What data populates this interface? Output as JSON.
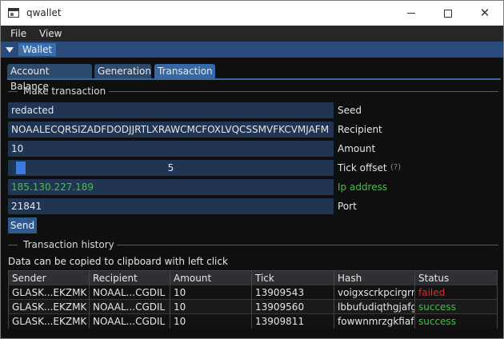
{
  "window": {
    "title": "qwallet"
  },
  "menu": {
    "file": "File",
    "view": "View"
  },
  "wallet_header": {
    "title": "Wallet"
  },
  "tabs": [
    {
      "label": "Account Balance",
      "active": false
    },
    {
      "label": "Generation",
      "active": false
    },
    {
      "label": "Transaction",
      "active": true
    }
  ],
  "make_transaction": {
    "section_label": "Make transaction",
    "seed": {
      "value": "redacted",
      "label": "Seed"
    },
    "recipient": {
      "value": "NOAALECQRSIZADFDODJJRTLXRAWCMCFOXLVQCSSMVFKCVMJAFM",
      "label": "Recipient"
    },
    "amount": {
      "value": "10",
      "label": "Amount"
    },
    "tick_offset": {
      "value": "5",
      "label": "Tick offset",
      "help": "(?)"
    },
    "ip_address": {
      "value": "185.130.227.189",
      "label": "Ip address"
    },
    "port": {
      "value": "21841",
      "label": "Port"
    },
    "send_label": "Send"
  },
  "history": {
    "section_label": "Transaction history",
    "info": "Data can be copied to clipboard with left click",
    "columns": [
      "Sender",
      "Recipient",
      "Amount",
      "Tick",
      "Hash",
      "Status"
    ],
    "rows": [
      [
        "GLASK...EKZMK",
        "NOAAL...CGDIL",
        "10",
        "13909543",
        "voigxscrkpcirgrrlv",
        "failed"
      ],
      [
        "GLASK...EKZMK",
        "NOAAL...CGDIL",
        "10",
        "13909560",
        "lbbufudiqthgjafgp",
        "success"
      ],
      [
        "GLASK...EKZMK",
        "NOAAL...CGDIL",
        "10",
        "13909811",
        "fowwnmrzgkfiafp",
        "success"
      ]
    ]
  },
  "colors": {
    "accent": "#3468a6",
    "header": "#294a7a",
    "field_bg": "#213451",
    "success": "#36c93b",
    "failed": "#e02a2a",
    "background": "#0f0f0f"
  },
  "icons": {
    "app": "app-window-icon",
    "minimize": "minimize-icon",
    "maximize": "maximize-icon",
    "close": "close-icon",
    "collapse": "triangle-down-icon"
  }
}
